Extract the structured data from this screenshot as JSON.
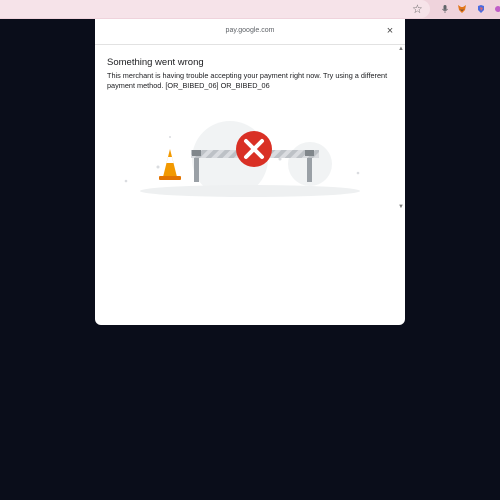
{
  "browser": {
    "toolbar_icons": [
      "star-icon",
      "microphone-icon",
      "fox-extension-icon",
      "puzzle-extension-icon"
    ]
  },
  "dialog": {
    "url": "pay.google.com",
    "close_label": "×",
    "title": "Something went wrong",
    "message": "This merchant is having trouble accepting your payment right now. Try using a different payment method. [OR_BIBED_06] OR_BIBED_06"
  },
  "colors": {
    "page_bg": "#0a0d1a",
    "browser_bar": "#efd3dc",
    "error_red": "#d93025",
    "cone_orange": "#f29900",
    "barrier_gray": "#9aa0a6"
  }
}
